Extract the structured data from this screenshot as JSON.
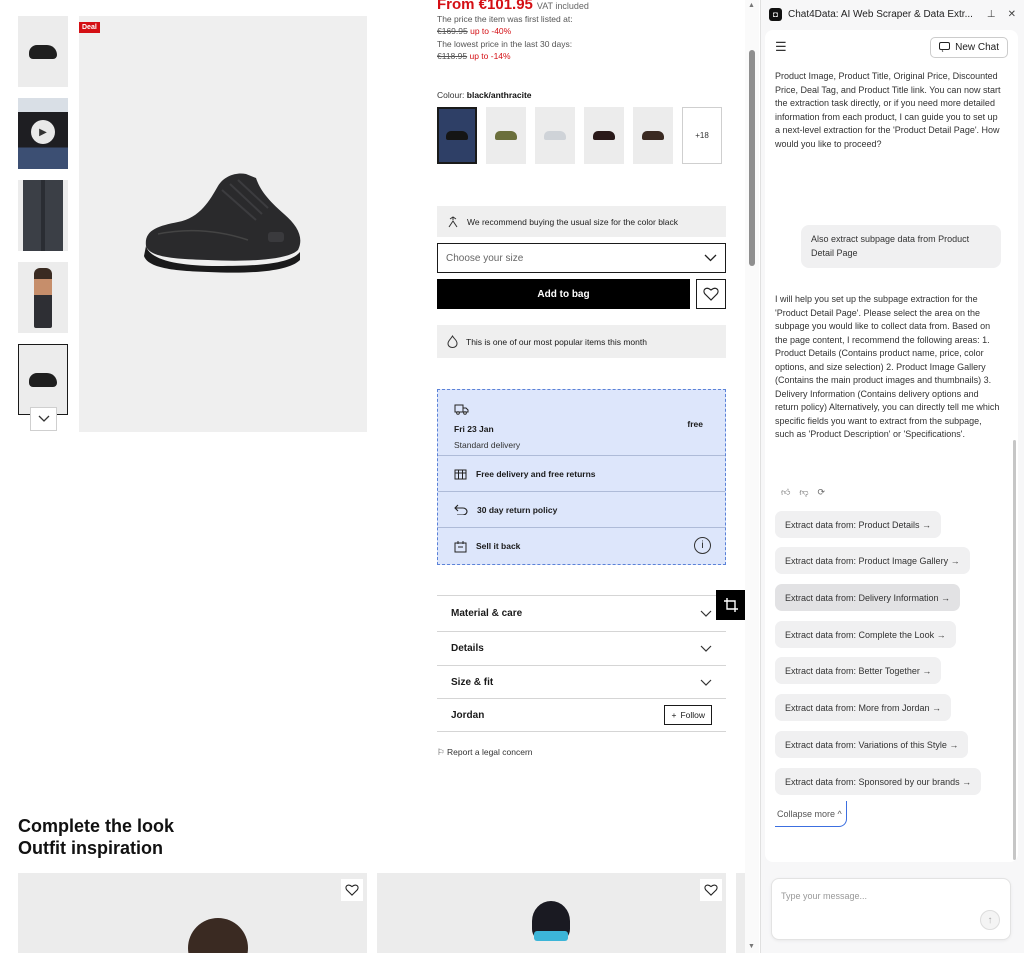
{
  "product": {
    "deal_badge": "Deal",
    "price": "From €101.95",
    "vat": "VAT included",
    "first_listed_label": "The price the item was first listed at:",
    "first_listed_price": "€169.95",
    "first_listed_discount": "up to -40%",
    "lowest_label": "The lowest price in the last 30 days:",
    "lowest_price": "€118.95",
    "lowest_discount": "up to -14%",
    "colour_label": "Colour:",
    "colour_value": "black/anthracite",
    "more_colours": "+18",
    "recommend_text": "We recommend buying the usual size for the color black",
    "size_placeholder": "Choose your size",
    "add_to_bag": "Add to bag",
    "popular_text": "This is one of our most popular items this month"
  },
  "delivery": {
    "date": "Fri 23 Jan",
    "price": "free",
    "type": "Standard delivery",
    "rows": [
      {
        "label": "Free delivery and free returns"
      },
      {
        "label": "30 day return policy"
      },
      {
        "label": "Sell it back"
      }
    ]
  },
  "accordion": {
    "material": "Material & care",
    "details": "Details",
    "size_fit": "Size & fit",
    "brand": "Jordan",
    "follow": "Follow"
  },
  "legal": "Report a legal concern",
  "complete_look": {
    "line1": "Complete the look",
    "line2": "Outfit inspiration"
  },
  "panel": {
    "title": "Chat4Data: AI Web Scraper & Data Extr...",
    "new_chat": "New Chat",
    "assistant_msg_1": "Product Image, Product Title, Original Price, Discounted Price, Deal Tag, and Product Title link. You can now start the extraction task directly, or if you need more detailed information from each product, I can guide you to set up a next-level extraction for the 'Product Detail Page'. How would you like to proceed?",
    "user_msg": "Also extract subpage data from Product Detail Page",
    "assistant_msg_2": "I will help you set up the subpage extraction for the 'Product Detail Page'. Please select the area on the subpage you would like to collect data from. Based on the page content, I recommend the following areas: 1. Product Details (Contains product name, price, color options, and size selection) 2. Product Image Gallery (Contains the main product images and thumbnails) 3. Delivery Information (Contains delivery options and return policy) Alternatively, you can directly tell me which specific fields you want to extract from the subpage, such as 'Product Description' or 'Specifications'.",
    "suggestions": [
      {
        "label": "Extract data from: Product Details →"
      },
      {
        "label": "Extract data from: Product Image Gallery →"
      },
      {
        "label": "Extract data from: Delivery Information →"
      },
      {
        "label": "Extract data from: Complete the Look →"
      },
      {
        "label": "Extract data from: Better Together →"
      },
      {
        "label": "Extract data from: More from Jordan →"
      },
      {
        "label": "Extract data from: Variations of this Style →"
      },
      {
        "label": "Extract data from: Sponsored by our brands →"
      }
    ],
    "collapse": "Collapse more ^",
    "input_placeholder": "Type your message..."
  }
}
